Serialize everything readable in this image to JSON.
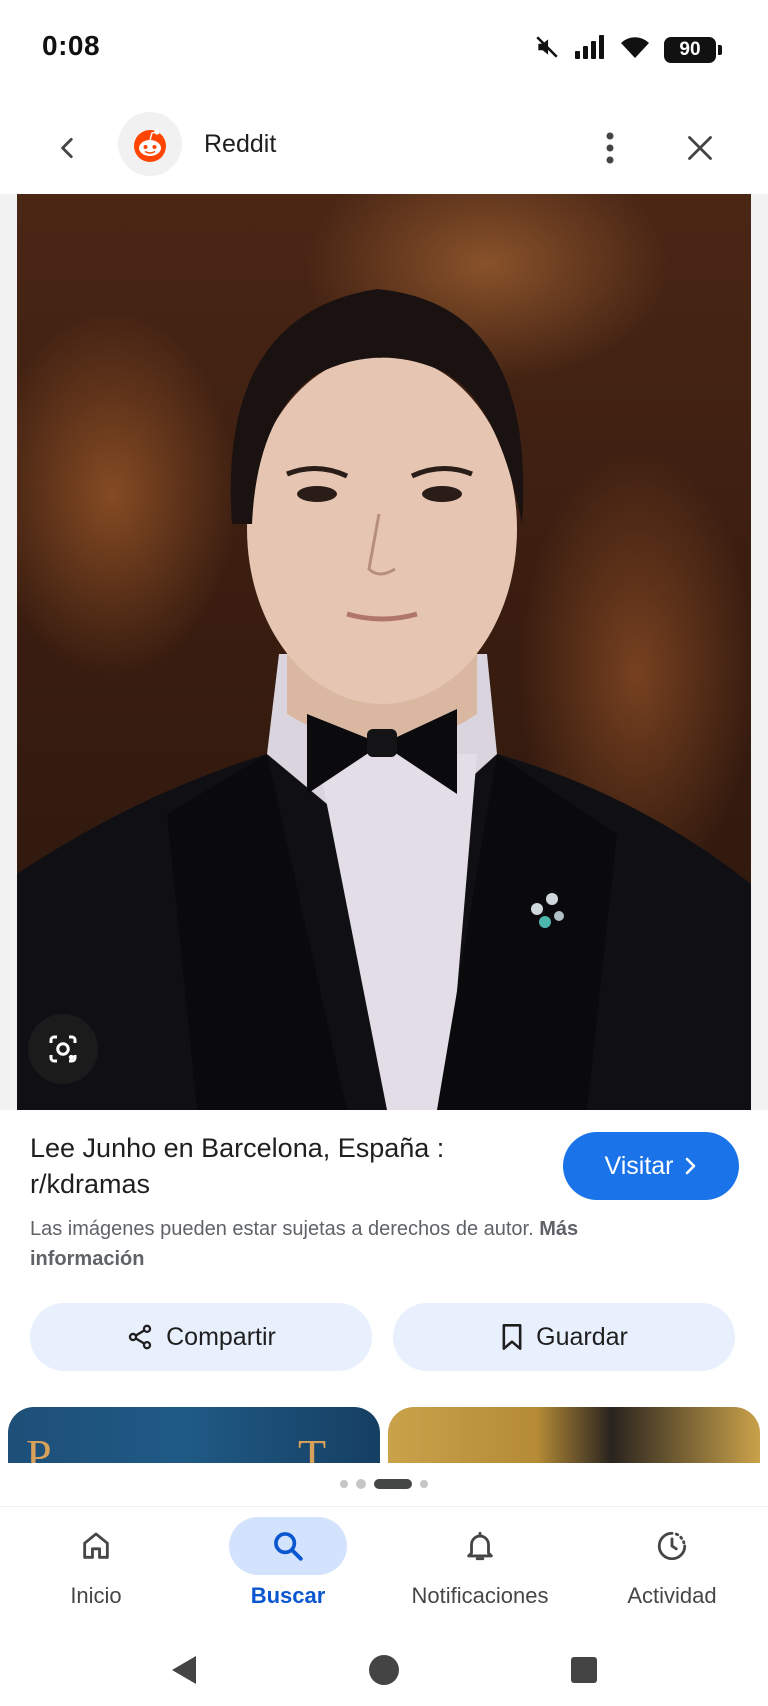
{
  "status_bar": {
    "time": "0:08",
    "battery": "90",
    "icons": [
      "mute-icon",
      "signal-icon",
      "wifi-icon",
      "battery-icon"
    ]
  },
  "header": {
    "site_name": "Reddit",
    "icons": [
      "back-arrow-icon",
      "reddit-logo-icon",
      "more-vert-icon",
      "close-icon"
    ]
  },
  "result": {
    "title": "Lee Junho en Barcelona, España : r/kdramas",
    "visit_label": "Visitar",
    "copyright_text": "Las imágenes pueden estar sujetas a derechos de autor.",
    "more_info_label": "Más información",
    "share_label": "Compartir",
    "save_label": "Guardar"
  },
  "related": {
    "thumb1_letters": [
      "P",
      "T"
    ]
  },
  "bottom_nav": {
    "items": [
      {
        "label": "Inicio",
        "icon": "home-icon"
      },
      {
        "label": "Buscar",
        "icon": "search-icon",
        "active": true
      },
      {
        "label": "Notificaciones",
        "icon": "bell-icon"
      },
      {
        "label": "Actividad",
        "icon": "activity-icon"
      }
    ]
  },
  "colors": {
    "accent": "#1a73e8",
    "pill_bg": "#e8f0fe",
    "nav_active_bg": "#d3e3fd",
    "nav_active_text": "#0b57d0"
  }
}
